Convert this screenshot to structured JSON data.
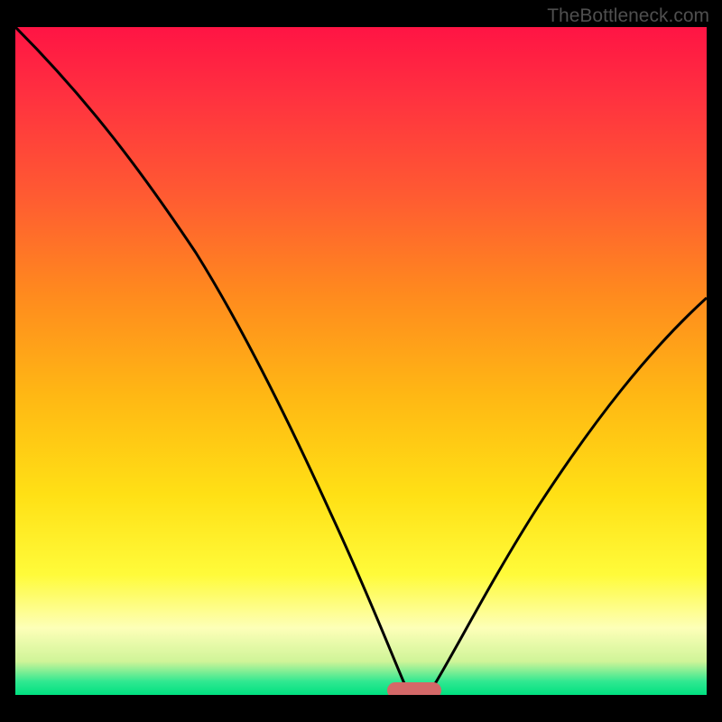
{
  "watermark": "TheBottleneck.com",
  "chart_data": {
    "type": "line",
    "title": "",
    "xlabel": "",
    "ylabel": "",
    "xlim": [
      0,
      100
    ],
    "ylim": [
      0,
      100
    ],
    "grid": false,
    "legend": false,
    "x": [
      0,
      5,
      10,
      15,
      20,
      25,
      30,
      35,
      40,
      45,
      50,
      55,
      57,
      59,
      60,
      62,
      65,
      70,
      75,
      80,
      85,
      90,
      95,
      100
    ],
    "values": [
      100,
      94,
      88,
      82,
      76,
      68,
      60,
      51,
      42,
      32,
      21,
      9,
      3,
      0.5,
      0,
      1,
      5,
      13,
      22,
      30,
      38,
      45,
      52,
      58
    ],
    "notes": "V-shaped bottleneck curve on rainbow gradient. Minimum (optimal point) at x≈60, pink marker there.",
    "colors": {
      "curve": "#000000",
      "gradient_top": "#ff1444",
      "gradient_bottom": "#00e080",
      "marker": "#d46868"
    }
  }
}
